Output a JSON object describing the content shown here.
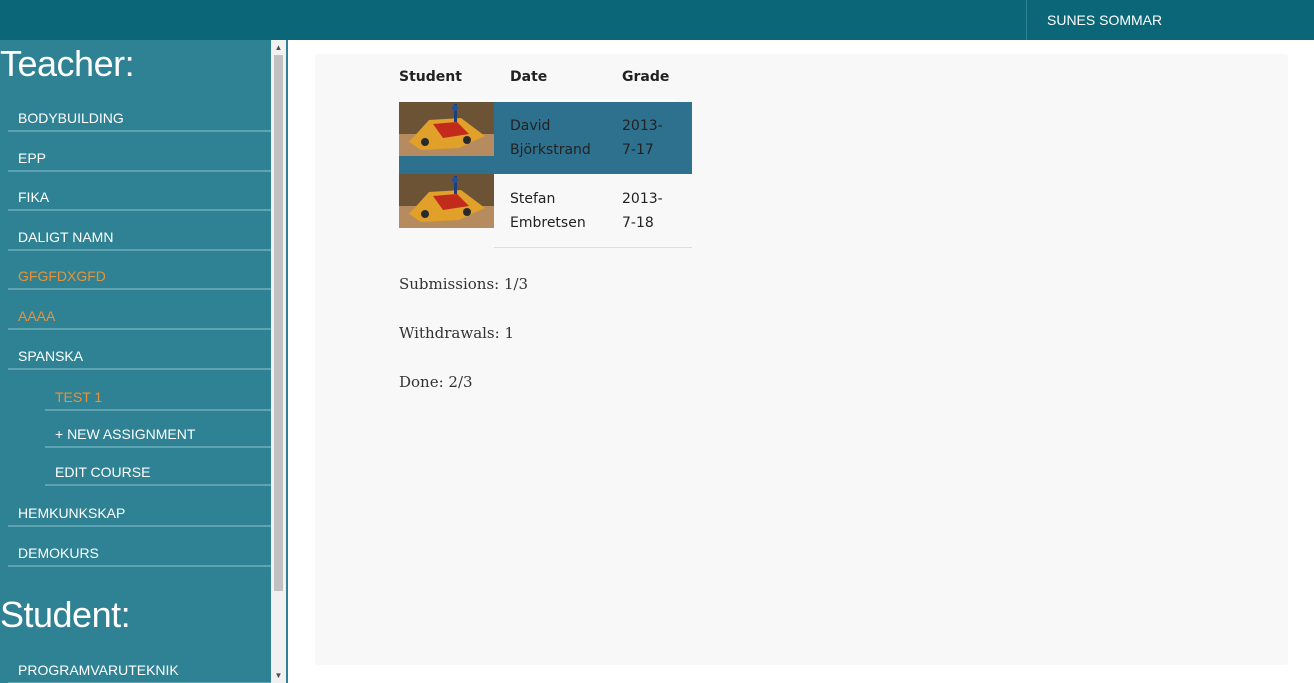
{
  "topbar": {
    "user_name": "SUNES SOMMAR"
  },
  "sidebar": {
    "teacher_title": "Teacher:",
    "teacher_courses": [
      {
        "label": "BODYBUILDING"
      },
      {
        "label": "EPP"
      },
      {
        "label": "FIKA"
      },
      {
        "label": "DALIGT NAMN"
      },
      {
        "label": "GFGFDXGFD"
      },
      {
        "label": "AAAA"
      },
      {
        "label": "SPANSKA"
      }
    ],
    "spanska_sub": [
      {
        "label": "TEST 1"
      },
      {
        "label": "+ NEW ASSIGNMENT"
      },
      {
        "label": "EDIT COURSE"
      }
    ],
    "teacher_courses_after": [
      {
        "label": "HEMKUNKSKAP"
      },
      {
        "label": "DEMOKURS"
      }
    ],
    "student_title": "Student:",
    "student_courses": [
      {
        "label": "PROGRAMVARUTEKNIK"
      }
    ]
  },
  "table": {
    "headers": {
      "student": "Student",
      "date": "Date",
      "grade": "Grade"
    },
    "rows": [
      {
        "student_line1": "David",
        "student_line2": "Björkstrand",
        "date_line1": "2013-",
        "date_line2": "7-17",
        "grade": ""
      },
      {
        "student_line1": "Stefan",
        "student_line2": "Embretsen",
        "date_line1": "2013-",
        "date_line2": "7-18",
        "grade": ""
      }
    ]
  },
  "stats": {
    "submissions": "Submissions: 1/3",
    "withdrawals": "Withdrawals: 1",
    "done": "Done: 2/3"
  },
  "colors": {
    "topbar": "#0b6677",
    "sidebar": "#2e8294",
    "active_link": "#e8933a",
    "selected_row": "#2e718f"
  },
  "icons": [
    "scroll-up-arrow-icon",
    "scroll-down-arrow-icon"
  ]
}
